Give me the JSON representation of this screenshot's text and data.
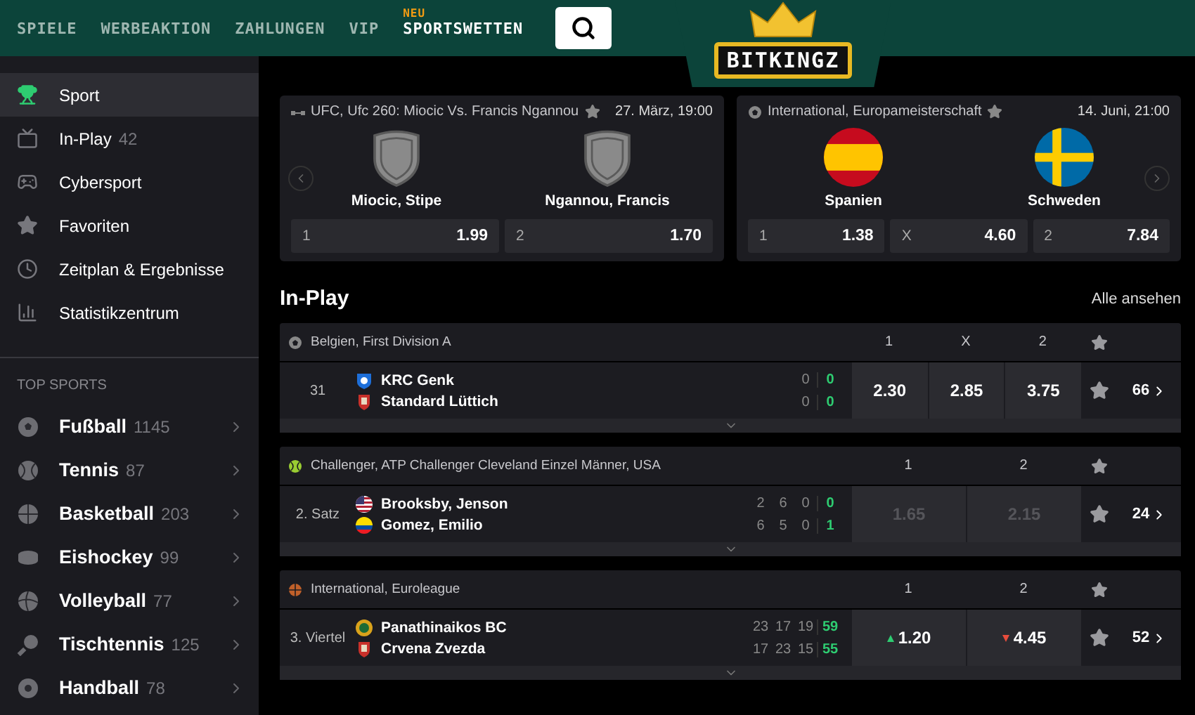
{
  "nav": {
    "items": [
      {
        "label": "SPIELE"
      },
      {
        "label": "WERBEAKTION"
      },
      {
        "label": "ZAHLUNGEN"
      },
      {
        "label": "VIP"
      },
      {
        "label": "SPORTSWETTEN",
        "badge": "NEU"
      }
    ],
    "logo": "BITKINGZ"
  },
  "sidebar": {
    "items": [
      {
        "label": "Sport",
        "kind": "trophy",
        "selected": true
      },
      {
        "label": "In-Play",
        "count": "42",
        "kind": "live",
        "selected": false
      },
      {
        "label": "Cybersport",
        "kind": "gamepad",
        "selected": false
      },
      {
        "label": "Favoriten",
        "kind": "star",
        "selected": false
      },
      {
        "label": "Zeitplan & Ergebnisse",
        "kind": "clock",
        "selected": false
      },
      {
        "label": "Statistikzentrum",
        "kind": "stats",
        "selected": false
      }
    ],
    "section_title": "TOP SPORTS",
    "sports": [
      {
        "label": "Fußball",
        "count": "1145",
        "kind": "football"
      },
      {
        "label": "Tennis",
        "count": "87",
        "kind": "tennis"
      },
      {
        "label": "Basketball",
        "count": "203",
        "kind": "basketball"
      },
      {
        "label": "Eishockey",
        "count": "99",
        "kind": "hockey"
      },
      {
        "label": "Volleyball",
        "count": "77",
        "kind": "volleyball"
      },
      {
        "label": "Tischtennis",
        "count": "125",
        "kind": "tabletennis"
      },
      {
        "label": "Handball",
        "count": "78",
        "kind": "handball"
      }
    ]
  },
  "featured": [
    {
      "kind": "mma",
      "league": "UFC, Ufc 260: Miocic Vs. Francis Ngannou",
      "date": "27. März, 19:00",
      "teams": [
        {
          "name": "Miocic, Stipe",
          "kind": "shield"
        },
        {
          "name": "Ngannou, Francis",
          "kind": "shield"
        }
      ],
      "odds": [
        {
          "label": "1",
          "value": "1.99"
        },
        {
          "label": "2",
          "value": "1.70"
        }
      ]
    },
    {
      "kind": "football",
      "league": "International, Europameisterschaft",
      "date": "14. Juni, 21:00",
      "teams": [
        {
          "name": "Spanien",
          "kind": "spain"
        },
        {
          "name": "Schweden",
          "kind": "sweden"
        }
      ],
      "odds": [
        {
          "label": "1",
          "value": "1.38"
        },
        {
          "label": "X",
          "value": "4.60"
        },
        {
          "label": "2",
          "value": "7.84"
        }
      ]
    }
  ],
  "inplay": {
    "title": "In-Play",
    "link": "Alle ansehen",
    "events": [
      {
        "kind": "football",
        "league": "Belgien, First Division A",
        "columns": [
          "1",
          "X",
          "2"
        ],
        "time": "31",
        "teams": [
          {
            "name": "KRC Genk",
            "kind": "crest-blue",
            "scores": [
              "0",
              "0"
            ]
          },
          {
            "name": "Standard Lüttich",
            "kind": "crest-red",
            "scores": [
              "0",
              "0"
            ]
          }
        ],
        "odds": [
          {
            "value": "2.30",
            "disabled": false,
            "kind": "plain"
          },
          {
            "value": "2.85",
            "disabled": false,
            "kind": "plain"
          },
          {
            "value": "3.75",
            "disabled": false,
            "kind": "plain"
          }
        ],
        "markets": "66"
      },
      {
        "kind": "tennis",
        "league": "Challenger, ATP Challenger Cleveland Einzel Männer, USA",
        "columns": [
          "1",
          "2"
        ],
        "time": "2. Satz",
        "teams": [
          {
            "name": "Brooksby, Jenson",
            "kind": "usa",
            "scores": [
              "2",
              "6",
              "0",
              "0"
            ]
          },
          {
            "name": "Gomez, Emilio",
            "kind": "ecuador",
            "scores": [
              "6",
              "5",
              "0",
              "1"
            ]
          }
        ],
        "odds": [
          {
            "value": "1.65",
            "disabled": true,
            "kind": "plain"
          },
          {
            "value": "2.15",
            "disabled": true,
            "kind": "plain"
          }
        ],
        "markets": "24"
      },
      {
        "kind": "basketball",
        "league": "International, Euroleague",
        "columns": [
          "1",
          "2"
        ],
        "time": "3. Viertel",
        "teams": [
          {
            "name": "Panathinaikos BC",
            "kind": "crest-green",
            "scores": [
              "23",
              "17",
              "19",
              "59"
            ]
          },
          {
            "name": "Crvena Zvezda",
            "kind": "crest-red",
            "scores": [
              "17",
              "23",
              "15",
              "55"
            ]
          }
        ],
        "odds": [
          {
            "value": "1.20",
            "disabled": false,
            "kind": "rising"
          },
          {
            "value": "4.45",
            "disabled": false,
            "kind": "falling"
          }
        ],
        "markets": "52"
      }
    ]
  }
}
